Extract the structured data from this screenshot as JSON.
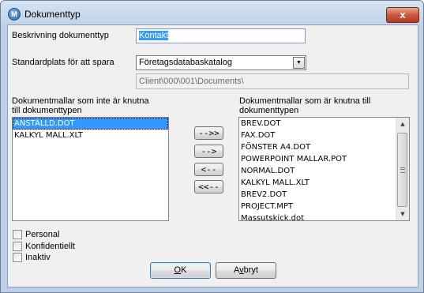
{
  "window": {
    "title": "Dokumenttyp",
    "close_glyph": "x",
    "app_icon": "app-logo-icon",
    "app_icon_glyph": "M"
  },
  "description": {
    "label": "Beskrivning dokumenttyp",
    "value": "Kontakt"
  },
  "storage": {
    "label": "Standardplats för att spara",
    "selected": "Företagsdatabaskatalog",
    "path": "Client\\000\\001\\Documents\\"
  },
  "left_list": {
    "label_line1": "Dokumentmallar som inte är knutna",
    "label_line2": "till dokumenttypen",
    "items": [
      "ANSTÄLLD.DOT",
      "KALKYL MALL.XLT"
    ],
    "selected_index": 0
  },
  "right_list": {
    "label_line1": "Dokumentmallar som är knutna till",
    "label_line2": "dokumenttypen",
    "items": [
      "BREV.DOT",
      "FAX.DOT",
      "FÖNSTER A4.DOT",
      "POWERPOINT MALLAR.POT",
      "NORMAL.DOT",
      "KALKYL MALL.XLT",
      "BREV2.DOT",
      "PROJECT.MPT",
      "Massutskick.dot"
    ]
  },
  "transfer_buttons": {
    "add_all": "-->>",
    "add": "-->",
    "remove": "<--",
    "remove_all": "<<--"
  },
  "checkboxes": [
    {
      "label": "Personal",
      "checked": false
    },
    {
      "label": "Konfidentiellt",
      "checked": false
    },
    {
      "label": "Inaktiv",
      "checked": false
    }
  ],
  "footer": {
    "ok_mnemonic": "O",
    "ok_rest": "K",
    "cancel_pre": "A",
    "cancel_mnemonic": "v",
    "cancel_rest": "bryt"
  }
}
